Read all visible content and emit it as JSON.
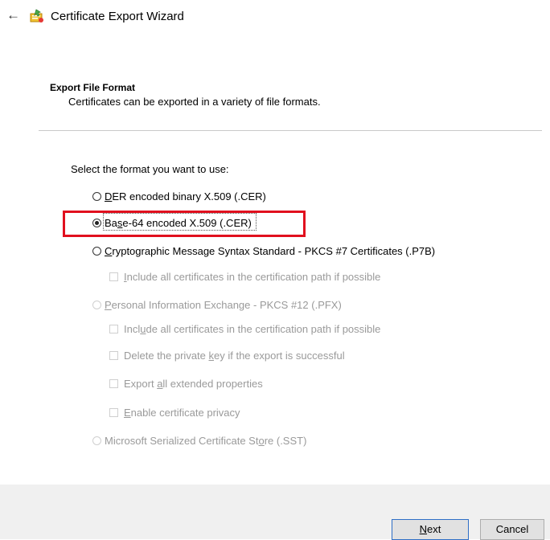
{
  "header": {
    "back_glyph": "←",
    "icon": "certificate-wizard-icon",
    "title": "Certificate Export Wizard"
  },
  "section": {
    "title": "Export File Format",
    "description": "Certificates can be exported in a variety of file formats."
  },
  "prompt": "Select the format you want to use:",
  "options": {
    "der": {
      "pre": "",
      "accel": "D",
      "post": "ER encoded binary X.509 (.CER)",
      "checked": false,
      "enabled": true
    },
    "base64": {
      "pre": "Ba",
      "accel": "s",
      "post": "e-64 encoded X.509 (.CER)",
      "checked": true,
      "enabled": true
    },
    "pkcs7": {
      "pre": "",
      "accel": "C",
      "post": "ryptographic Message Syntax Standard - PKCS #7 Certificates (.P7B)",
      "checked": false,
      "enabled": true
    },
    "pkcs7_include": {
      "pre": "",
      "accel": "I",
      "post": "nclude all certificates in the certification path if possible",
      "checked": false,
      "enabled": false
    },
    "pfx": {
      "pre": "",
      "accel": "P",
      "post": "ersonal Information Exchange - PKCS #12 (.PFX)",
      "checked": false,
      "enabled": false
    },
    "pfx_include": {
      "pre": "Incl",
      "accel": "u",
      "post": "de all certificates in the certification path if possible",
      "checked": false,
      "enabled": false
    },
    "pfx_delete_key": {
      "pre": "Delete the private ",
      "accel": "k",
      "post": "ey if the export is successful",
      "checked": false,
      "enabled": false
    },
    "pfx_export_props": {
      "pre": "Export ",
      "accel": "a",
      "post": "ll extended properties",
      "checked": false,
      "enabled": false
    },
    "pfx_privacy": {
      "pre": "",
      "accel": "E",
      "post": "nable certificate privacy",
      "checked": false,
      "enabled": false
    },
    "sst": {
      "pre": "Microsoft Serialized Certificate St",
      "accel": "o",
      "post": "re (.SST)",
      "checked": false,
      "enabled": false
    }
  },
  "buttons": {
    "next": {
      "pre": "",
      "accel": "N",
      "post": "ext"
    },
    "cancel": "Cancel"
  },
  "colors": {
    "highlight": "#e1101e",
    "next_border": "#2f6fc6",
    "disabled_text": "#9a9a9a"
  }
}
